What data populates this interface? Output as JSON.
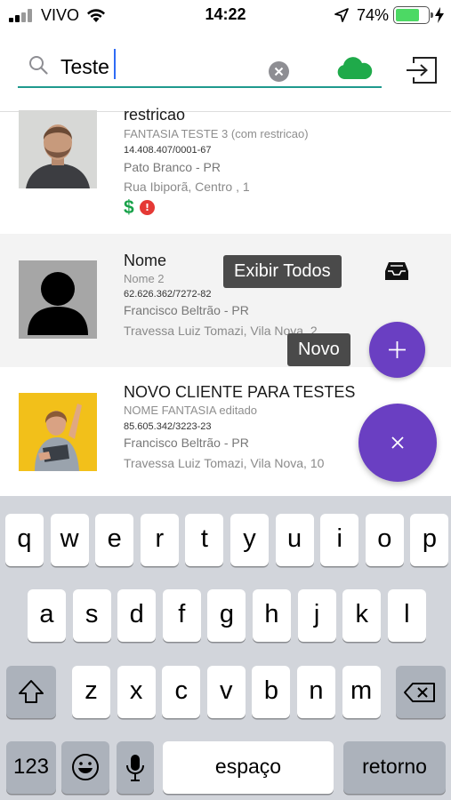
{
  "status_bar": {
    "carrier": "VIVO",
    "time": "14:22",
    "battery": "74%",
    "battery_level": 0.74,
    "icons": [
      "signal-icon",
      "wifi-icon",
      "location-arrow-icon",
      "battery-icon",
      "charging-bolt-icon"
    ]
  },
  "search": {
    "value": "Teste",
    "icons": [
      "search-icon",
      "clear-icon",
      "cloud-sync-icon",
      "exit-icon"
    ]
  },
  "clients": [
    {
      "name": "restricao",
      "fantasy": "FANTASIA TESTE 3 (com restricao)",
      "document": "14.408.407/0001-67",
      "city": "Pato Branco - PR",
      "address": "Rua Ibiporã, Centro , 1",
      "badges": [
        "dollar-icon",
        "alert-icon"
      ]
    },
    {
      "name": "Nome",
      "fantasy": "Nome 2",
      "document": "62.626.362/7272-82",
      "city": "Francisco Beltrão - PR",
      "address": "Travessa Luiz Tomazi, Vila Nova, 2"
    },
    {
      "name": "NOVO CLIENTE PARA TESTES",
      "fantasy": "NOME FANTASIA editado",
      "document": "85.605.342/3223-23",
      "city": "Francisco Beltrão - PR",
      "address": "Travessa Luiz Tomazi, Vila Nova, 10"
    }
  ],
  "fab_menu": {
    "show_all_label": "Exibir Todos",
    "new_label": "Novo",
    "accent_color": "#6a3fc2"
  },
  "keyboard": {
    "row1": [
      "q",
      "w",
      "e",
      "r",
      "t",
      "y",
      "u",
      "i",
      "o",
      "p"
    ],
    "row2": [
      "a",
      "s",
      "d",
      "f",
      "g",
      "h",
      "j",
      "k",
      "l"
    ],
    "row3": [
      "z",
      "x",
      "c",
      "v",
      "b",
      "n",
      "m"
    ],
    "numbers_label": "123",
    "space_label": "espaço",
    "return_label": "retorno"
  }
}
